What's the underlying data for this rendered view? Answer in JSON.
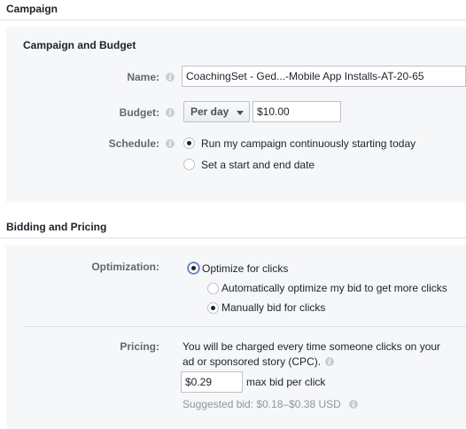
{
  "campaign": {
    "section_title": "Campaign",
    "subsection_title": "Campaign and Budget",
    "name_label": "Name:",
    "name_value": "CoachingSet - Ged...-Mobile App Installs-AT-20-65",
    "budget_label": "Budget:",
    "budget_type": "Per day",
    "budget_amount": "$10.00",
    "schedule_label": "Schedule:",
    "schedule_options": [
      {
        "label": "Run my campaign continuously starting today",
        "selected": true
      },
      {
        "label": "Set a start and end date",
        "selected": false
      }
    ]
  },
  "bidding": {
    "section_title": "Bidding and Pricing",
    "optimization_label": "Optimization:",
    "optimize_clicks_label": "Optimize for clicks",
    "auto_bid_label": "Automatically optimize my bid to get more clicks",
    "manual_bid_label": "Manually bid for clicks",
    "pricing_label": "Pricing:",
    "pricing_line1": "You will be charged every time someone clicks on your",
    "pricing_line2": "ad or sponsored story (CPC).",
    "bid_value": "$0.29",
    "bid_suffix": "max bid per click",
    "suggested_bid": "Suggested bid: $0.18–$0.38 USD"
  },
  "icons": {
    "info": "info-icon",
    "dropdown": "chevron-down-icon"
  },
  "colors": {
    "panel_bg": "#f6f7f9",
    "label_gray": "#606770",
    "focus_blue": "#4267b2"
  }
}
